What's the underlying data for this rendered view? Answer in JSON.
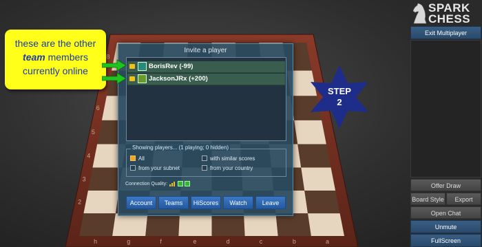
{
  "window": {
    "title": "SparkChess - Invite a player"
  },
  "logo": {
    "line1": "SPARK",
    "line2": "CHESS"
  },
  "sidebar": {
    "exit_label": "Exit Multiplayer",
    "offer_draw_label": "Offer Draw",
    "board_style_label": "Board Style",
    "export_label": "Export",
    "open_chat_label": "Open Chat",
    "unmute_label": "Unmute",
    "fullscreen_label": "FullScreen"
  },
  "board": {
    "files": [
      "h",
      "g",
      "f",
      "e",
      "d",
      "c",
      "b",
      "a"
    ],
    "ranks": [
      "8",
      "7",
      "6",
      "5",
      "4",
      "3",
      "2"
    ]
  },
  "dialog": {
    "title": "Invite a player",
    "players": [
      {
        "name": "BorisRev",
        "score": "(-99)"
      },
      {
        "name": "JacksonJRx",
        "score": "(+200)"
      }
    ],
    "showing_label": "Showing players... (1 playing; 0 hidden)",
    "options": {
      "all": "All",
      "similar_scores": "with similar scores",
      "subnet": "from your subnet",
      "country": "from your country"
    },
    "connection_quality_label": "Connection Quality:",
    "buttons": {
      "account": "Account",
      "teams": "Teams",
      "hiscores": "HiScores",
      "watch": "Watch",
      "leave": "Leave"
    }
  },
  "annotation": {
    "line1": "these are the  other",
    "line2_bold": "team",
    "line2_rest": " members",
    "line3": "currently online",
    "step_word": "STEP",
    "step_number": "2"
  },
  "colors": {
    "annotation_bg": "#ffff1a",
    "annotation_text": "#1c3aa8",
    "star": "#1f2d8a",
    "arrow": "#1fc41f",
    "button_blue": "#2f69b4"
  }
}
